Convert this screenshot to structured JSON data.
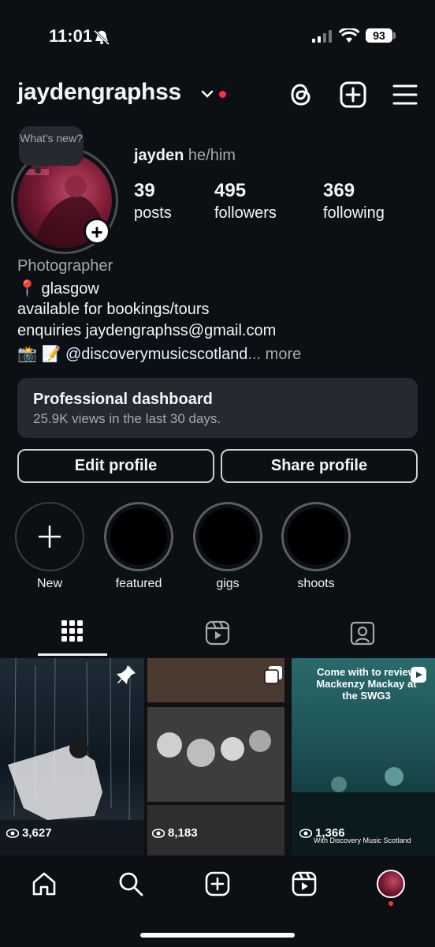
{
  "status": {
    "time": "11:01",
    "battery": "93"
  },
  "header": {
    "username": "jaydengraphss"
  },
  "note": {
    "text": "What's new?"
  },
  "profile": {
    "name": "jayden",
    "pronouns": "he/him"
  },
  "stats": [
    {
      "value": "39",
      "label": "posts"
    },
    {
      "value": "495",
      "label": "followers"
    },
    {
      "value": "369",
      "label": "following"
    }
  ],
  "bio": {
    "category": "Photographer",
    "line1": "📍 glasgow",
    "line2": "available for bookings/tours",
    "line3": "enquiries jaydengraphss@gmail.com",
    "emojis": "📸 📝",
    "mention": "@discoverymusicscotland",
    "more": "... more"
  },
  "dashboard": {
    "title": "Professional dashboard",
    "subtitle": "25.9K views in the last 30 days."
  },
  "buttons": {
    "edit": "Edit profile",
    "share": "Share profile"
  },
  "highlights": [
    {
      "label": "New"
    },
    {
      "label": "featured"
    },
    {
      "label": "gigs"
    },
    {
      "label": "shoots"
    }
  ],
  "posts": [
    {
      "views": "3,627"
    },
    {
      "views": "8,183"
    },
    {
      "views": "1,366",
      "overlay": "Come with to review Mackenzy Mackay at the SWG3",
      "watermark": "With Discovery Music Scotland"
    }
  ],
  "colors": {
    "background": "#0c1014",
    "live_dot": "#ff3040",
    "link": "#e0f1ff"
  }
}
